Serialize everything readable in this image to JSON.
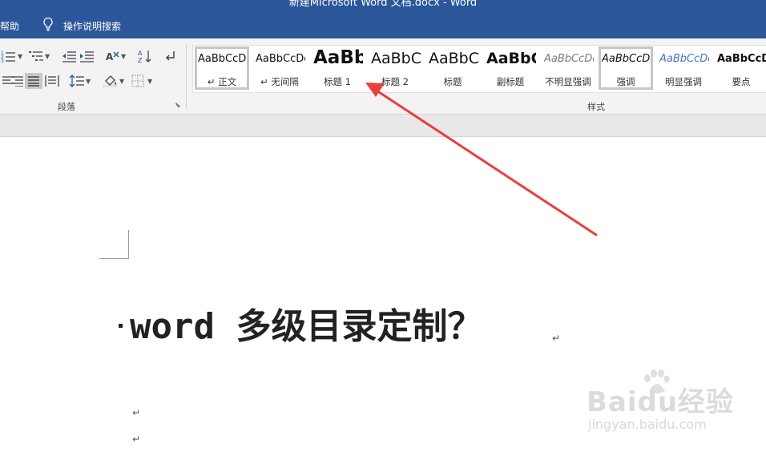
{
  "window": {
    "title": "新建Microsoft Word 文档.docx - Word"
  },
  "tabs": {
    "help": "帮助",
    "tell_me": "操作说明搜索"
  },
  "ribbon": {
    "paragraph_group_label": "段落",
    "styles_group_label": "样式",
    "styles": [
      {
        "preview": "AaBbCcDd",
        "name": "↵ 正文",
        "selected": true
      },
      {
        "preview": "AaBbCcDd",
        "name": "↵ 无间隔",
        "selected": false
      },
      {
        "preview": "AaBb",
        "name": "标题 1",
        "selected": false
      },
      {
        "preview": "AaBbC",
        "name": "标题 2",
        "selected": false
      },
      {
        "preview": "AaBbC",
        "name": "标题",
        "selected": false
      },
      {
        "preview": "AaBbC",
        "name": "副标题",
        "selected": false
      },
      {
        "preview": "AaBbCcDd",
        "name": "不明显强调",
        "selected": false
      },
      {
        "preview": "AaBbCcDd",
        "name": "强调",
        "selected": true
      },
      {
        "preview": "AaBbCcDd",
        "name": "明显强调",
        "selected": false
      },
      {
        "preview": "AaBbCcDd",
        "name": "要点",
        "selected": false
      }
    ]
  },
  "document": {
    "heading": "word 多级目录定制？",
    "paragraph_mark": "↵"
  },
  "watermark": {
    "brand": "Baidu经验",
    "url": "jingyan.baidu.com"
  },
  "colors": {
    "titlebar": "#2b579a",
    "annotation_arrow": "#e8403a"
  }
}
